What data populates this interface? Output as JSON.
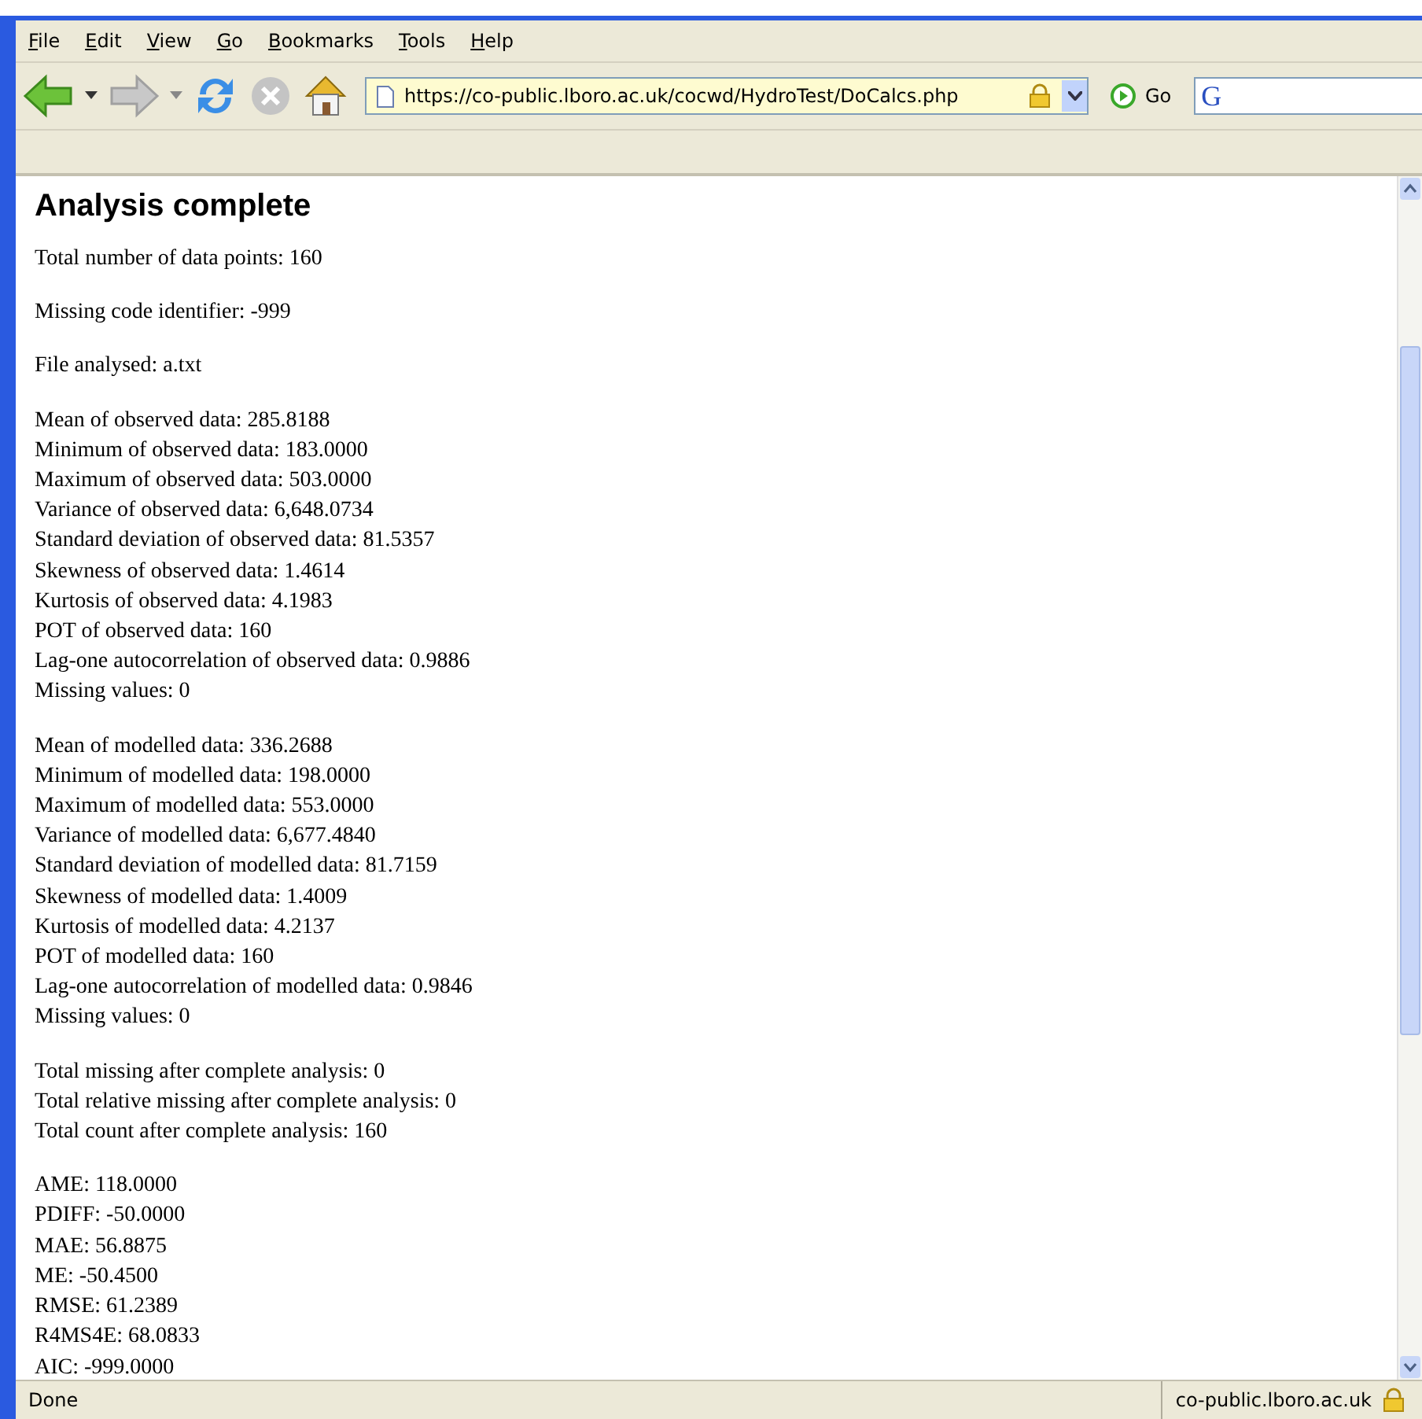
{
  "menu": [
    "File",
    "Edit",
    "View",
    "Go",
    "Bookmarks",
    "Tools",
    "Help"
  ],
  "toolbar": {
    "url": "https://co-public.lboro.ac.uk/cocwd/HydroTest/DoCalcs.php",
    "go_label": "Go",
    "search_logo": "G",
    "back_disabled": false,
    "forward_disabled": true,
    "stop_disabled": true,
    "secure": true
  },
  "page": {
    "heading": "Analysis complete",
    "paragraphs": [
      [
        "Total number of data points: 160"
      ],
      [
        "Missing code identifier: -999"
      ],
      [
        "File analysed: a.txt"
      ],
      [
        "Mean of observed data: 285.8188",
        "Minimum of observed data: 183.0000",
        "Maximum of observed data: 503.0000",
        "Variance of observed data: 6,648.0734",
        "Standard deviation of observed data: 81.5357",
        "Skewness of observed data: 1.4614",
        "Kurtosis of observed data: 4.1983",
        "POT of observed data: 160",
        "Lag-one autocorrelation of observed data: 0.9886",
        "Missing values: 0"
      ],
      [
        "Mean of modelled data: 336.2688",
        "Minimum of modelled data: 198.0000",
        "Maximum of modelled data: 553.0000",
        "Variance of modelled data: 6,677.4840",
        "Standard deviation of modelled data: 81.7159",
        "Skewness of modelled data: 1.4009",
        "Kurtosis of modelled data: 4.2137",
        "POT of modelled data: 160",
        "Lag-one autocorrelation of modelled data: 0.9846",
        "Missing values: 0"
      ],
      [
        "Total missing after complete analysis: 0",
        "Total relative missing after complete analysis: 0",
        "Total count after complete analysis: 160"
      ],
      [
        "AME: 118.0000",
        "PDIFF: -50.0000",
        "MAE: 56.8875",
        "ME: -50.4500",
        "RMSE: 61.2389",
        "R4MS4E: 68.0833",
        "AIC: -999.0000"
      ]
    ]
  },
  "status_bar": {
    "text": "Done",
    "host": "co-public.lboro.ac.uk"
  }
}
